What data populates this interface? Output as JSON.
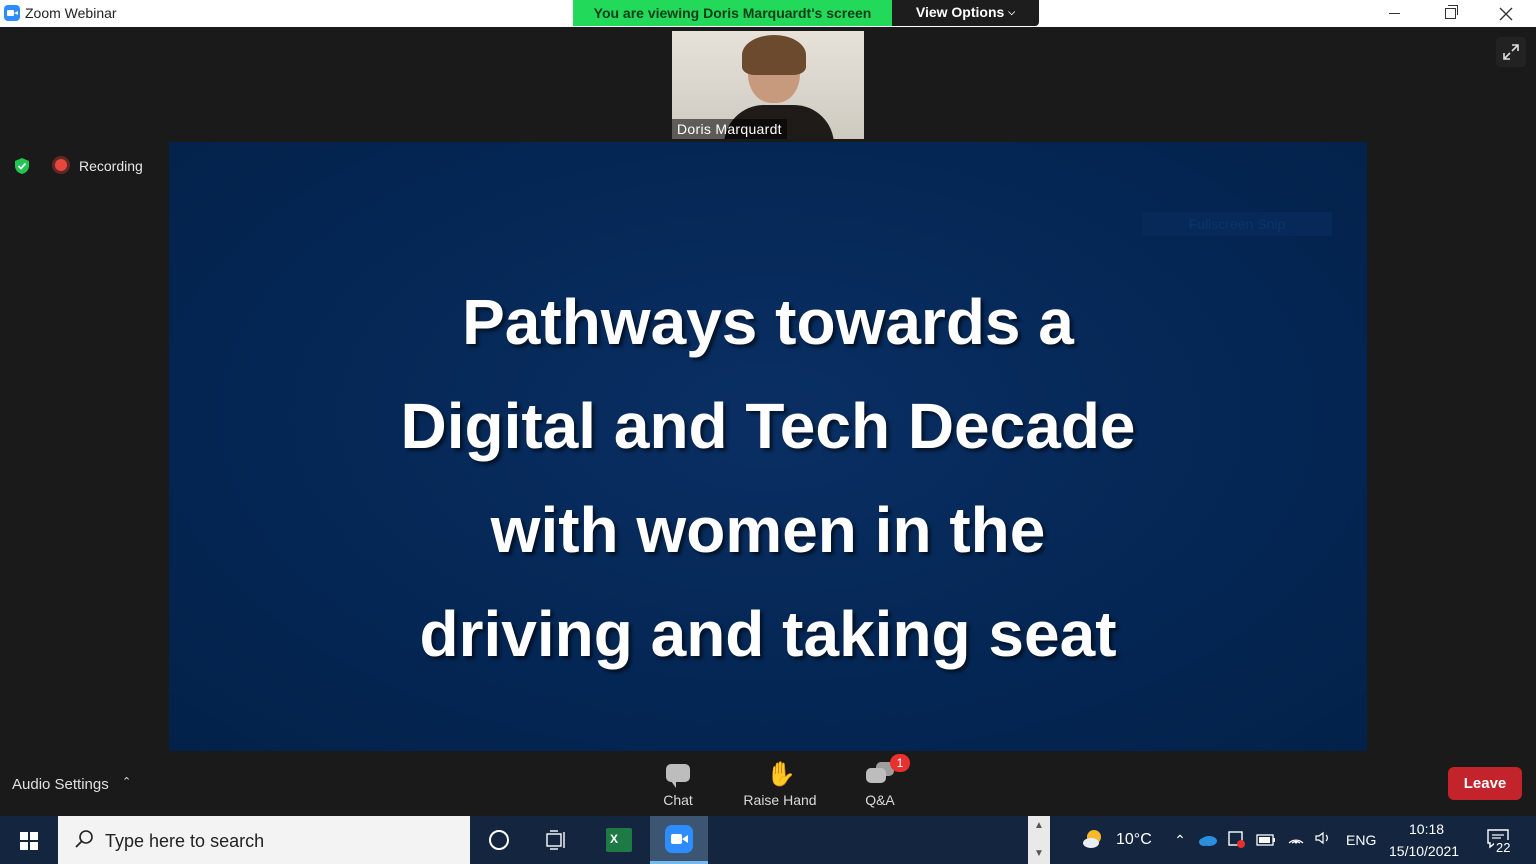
{
  "window": {
    "title": "Zoom Webinar",
    "viewing_banner": "You are viewing Doris Marquardt's screen",
    "view_options_label": "View Options"
  },
  "meeting": {
    "speaker_name": "Doris Marquardt",
    "recording_label": "Recording",
    "slide_lines": [
      "Pathways towards a",
      "Digital and Tech Decade",
      "with women in the",
      "driving and taking seat"
    ],
    "faint_overlay_label": "Fullscreen Snip"
  },
  "toolbar": {
    "audio_settings_label": "Audio Settings",
    "chat_label": "Chat",
    "raise_hand_label": "Raise Hand",
    "qa_label": "Q&A",
    "qa_badge_count": "1",
    "leave_label": "Leave"
  },
  "taskbar": {
    "search_placeholder": "Type here to search",
    "weather_temp": "10°C",
    "language": "ENG",
    "time": "10:18",
    "date": "15/10/2021",
    "notification_count": "22"
  },
  "colors": {
    "banner_green": "#23d959",
    "slide_background": "#042654",
    "leave_red": "#c3232a",
    "badge_red": "#e8312e",
    "zoom_blue": "#2d8cff",
    "taskbar": "#14263f"
  },
  "icons": {
    "app": "zoom-camera-icon",
    "security": "shield-check-icon",
    "recording": "record-dot-icon",
    "fullscreen": "expand-arrows-icon",
    "chat": "chat-bubble-icon",
    "raise_hand": "hand-icon",
    "qa": "qa-bubbles-icon",
    "start": "windows-logo-icon",
    "search": "magnifier-icon",
    "cortana": "circle-icon",
    "task_view": "task-view-icon",
    "excel": "excel-icon",
    "zoom": "zoom-icon",
    "weather": "partly-sunny-icon",
    "notifications": "notification-bubble-icon"
  }
}
